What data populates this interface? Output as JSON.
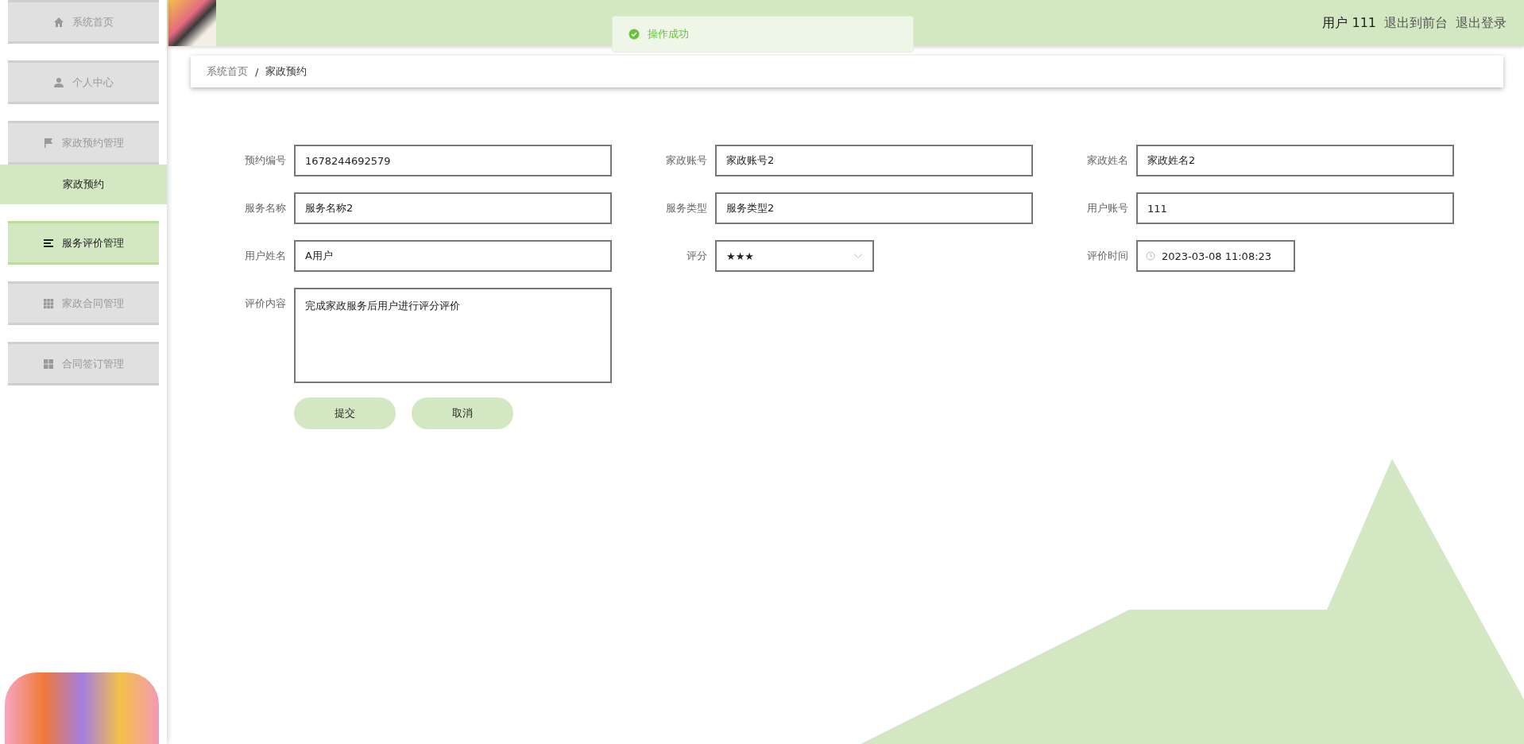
{
  "sidebar": {
    "items": [
      {
        "label": "系统首页",
        "selected": false
      },
      {
        "label": "个人中心",
        "selected": false
      },
      {
        "label": "家政预约管理",
        "selected": false,
        "expanded": true,
        "children": [
          {
            "label": "家政预约",
            "selected": true
          }
        ]
      },
      {
        "label": "服务评价管理",
        "selected": true
      },
      {
        "label": "家政合同管理",
        "selected": false
      },
      {
        "label": "合同签订管理",
        "selected": false
      }
    ]
  },
  "topbar": {
    "user": "用户 111",
    "links": [
      "退出到前台",
      "退出登录"
    ]
  },
  "toast": {
    "message": "操作成功"
  },
  "breadcrumb": {
    "items": [
      "系统首页",
      "家政预约"
    ],
    "separator": "/"
  },
  "form": {
    "fields": [
      {
        "label": "预约编号",
        "value": "1678244692579",
        "kind": "text"
      },
      {
        "label": "家政账号",
        "value": "家政账号2",
        "kind": "text"
      },
      {
        "label": "家政姓名",
        "value": "家政姓名2",
        "kind": "text"
      },
      {
        "label": "服务名称",
        "value": "服务名称2",
        "kind": "text"
      },
      {
        "label": "服务类型",
        "value": "服务类型2",
        "kind": "text"
      },
      {
        "label": "用户账号",
        "value": "111",
        "kind": "text"
      },
      {
        "label": "用户姓名",
        "value": "A用户",
        "kind": "text"
      },
      {
        "label": "评分",
        "value": "★★★",
        "kind": "select"
      },
      {
        "label": "评价时间",
        "value": "2023-03-08 11:08:23",
        "kind": "datetime"
      },
      {
        "label": "评价内容",
        "value": "完成家政服务后用户进行评分评价",
        "kind": "textarea"
      }
    ],
    "buttons": [
      "提交",
      "取消"
    ]
  }
}
